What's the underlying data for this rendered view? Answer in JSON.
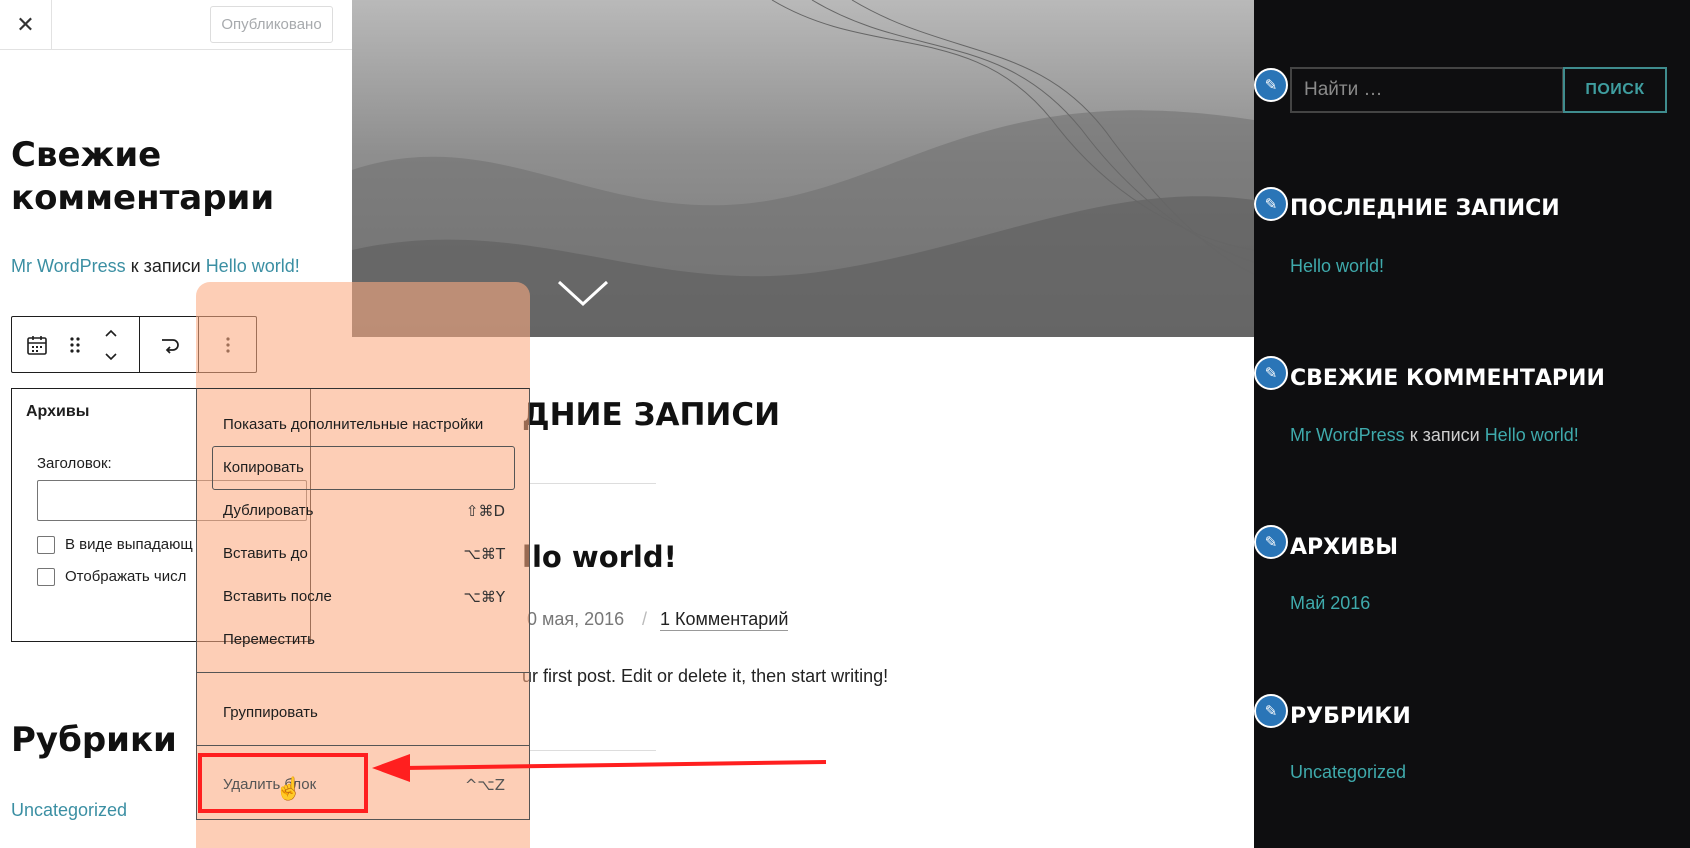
{
  "left_panel": {
    "close_icon": "close-icon",
    "publish_label": "Опубликовано",
    "comments_heading": "Свежие комментарии",
    "comment": {
      "author": "Mr WordPress",
      "middle": " к записи ",
      "post": "Hello world!"
    },
    "toolbar_icons": [
      "calendar-icon",
      "drag-handle-icon",
      "move-up-down-icon",
      "transform-icon",
      "more-options-icon"
    ],
    "archives_block": {
      "title": "Архивы",
      "field_label": "Заголовок:",
      "field_value": "",
      "checkboxes": [
        "В виде выпадающ",
        "Отображать числ"
      ]
    },
    "categories_heading": "Рубрики",
    "category_link": "Uncategorized"
  },
  "main": {
    "section_title": "ДНИЕ ЗАПИСИ",
    "post_title": "llo world!",
    "post_date": "0 мая, 2016",
    "separator": "/",
    "comments_link": "1 Комментарий",
    "excerpt": "ur first post. Edit or delete it, then start writing!"
  },
  "context_menu": {
    "items": [
      {
        "label": "Показать дополнительные настройки",
        "shortcut": ""
      },
      {
        "label": "Копировать",
        "shortcut": ""
      },
      {
        "label": "Дублировать",
        "shortcut": "⇧⌘D"
      },
      {
        "label": "Вставить до",
        "shortcut": "⌥⌘T"
      },
      {
        "label": "Вставить после",
        "shortcut": "⌥⌘Y"
      },
      {
        "label": "Переместить",
        "shortcut": ""
      },
      {
        "label": "Группировать",
        "shortcut": ""
      },
      {
        "label": "Удалить блок",
        "shortcut": "^⌥Z"
      }
    ]
  },
  "sidebar": {
    "search_placeholder": "Найти …",
    "search_button": "ПОИСК",
    "recent_posts_heading": "ПОСЛЕДНИЕ ЗАПИСИ",
    "recent_post": "Hello world!",
    "recent_comments_heading": "СВЕЖИЕ КОММЕНТАРИИ",
    "comment": {
      "author": "Mr WordPress",
      "middle": " к записи ",
      "post": "Hello world!"
    },
    "archives_heading": "АРХИВЫ",
    "archive_link": "Май 2016",
    "categories_heading": "РУБРИКИ",
    "category_link": "Uncategorized"
  },
  "colors": {
    "accent_teal": "#3faaac",
    "annotation_red": "#ff1f1f",
    "overlay_orange": "#fbaa82",
    "edit_blue": "#2a75b7"
  }
}
